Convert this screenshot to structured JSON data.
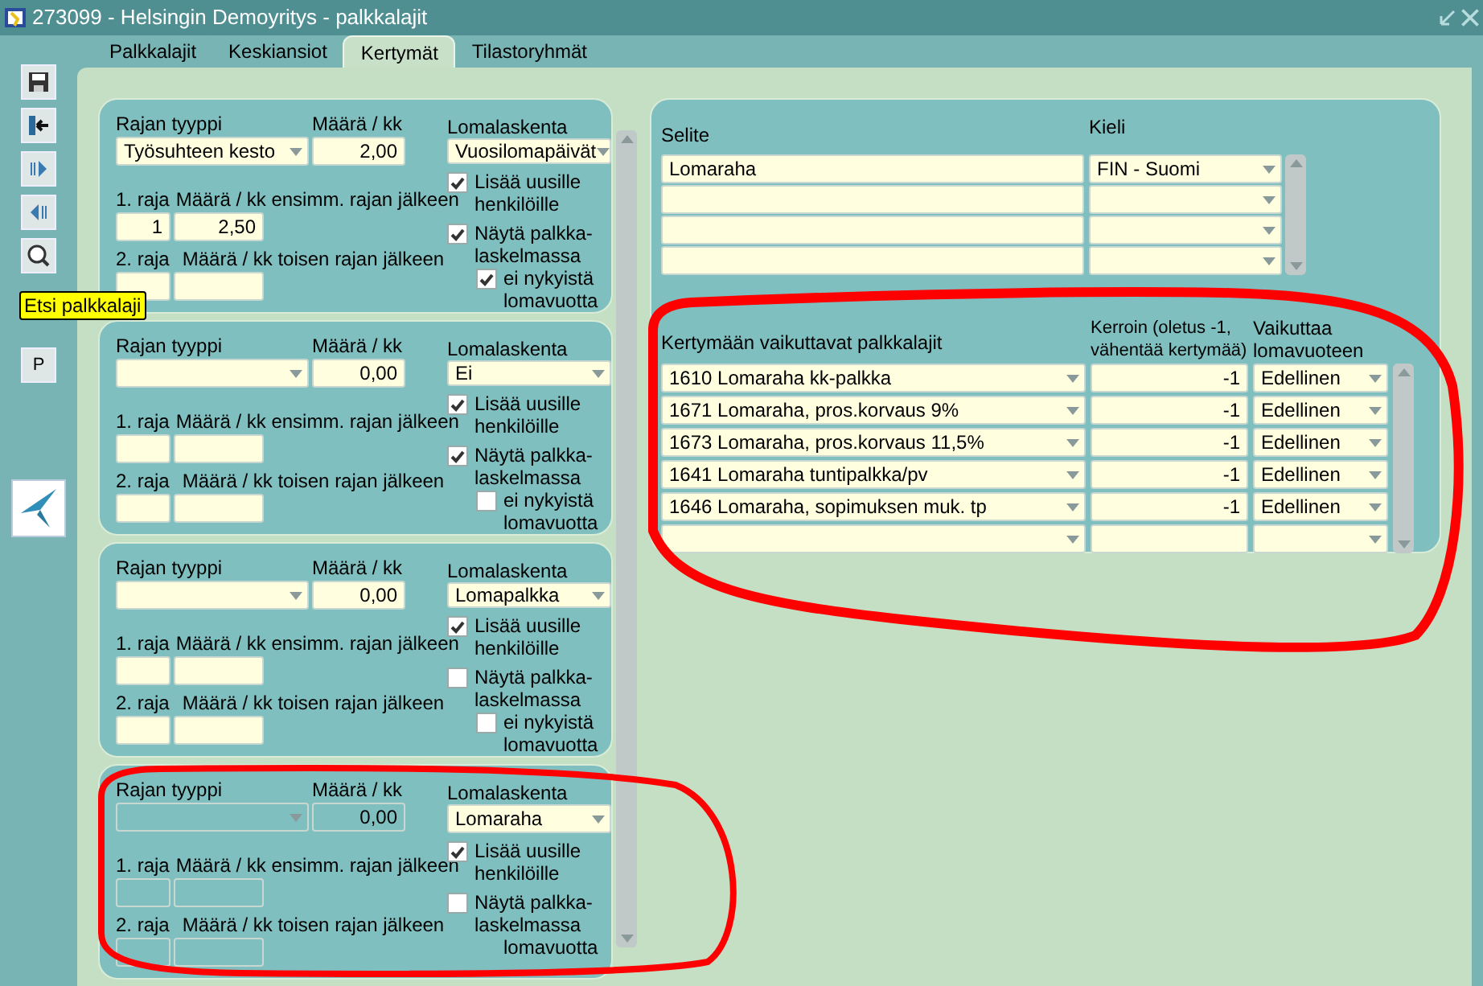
{
  "window": {
    "title": "273099 - Helsingin Demoyritys - palkkalajit"
  },
  "toolbar": {
    "tooltip": "Etsi palkkalaji",
    "p_button": "P"
  },
  "tabs": [
    {
      "label": "Palkkalajit",
      "selected": false
    },
    {
      "label": "Keskiansiot",
      "selected": false
    },
    {
      "label": "Kertymät",
      "selected": true
    },
    {
      "label": "Tilastoryhmät",
      "selected": false
    }
  ],
  "records": [
    {
      "disabled": false,
      "labels": {
        "type": "Rajan tyyppi",
        "amount": "Määrä / kk",
        "vacation_calc": "Lomalaskenta",
        "limit1": "1. raja",
        "amount1": "Määrä / kk ensimm. rajan jälkeen",
        "limit2": "2. raja",
        "amount2": "Määrä / kk toisen rajan jälkeen",
        "add_new": "Lisää uusille henkilöille",
        "show": "Näytä palkka-laskelmassa",
        "not_current": "ei nykyistä lomavuotta"
      },
      "type": "Työsuhteen kesto",
      "amount": "2,00",
      "vacation_calc": "Vuosilomapäivät",
      "limit1": "1",
      "amount1": "2,50",
      "add_new_checked": true,
      "show_checked": true,
      "not_current_checked": true
    },
    {
      "disabled": false,
      "labels": {
        "type": "Rajan tyyppi",
        "amount": "Määrä / kk",
        "vacation_calc": "Lomalaskenta",
        "limit1": "1. raja",
        "amount1": "Määrä / kk ensimm. rajan jälkeen",
        "limit2": "2. raja",
        "amount2": "Määrä / kk toisen rajan jälkeen",
        "add_new": "Lisää uusille henkilöille",
        "show": "Näytä palkka-laskelmassa",
        "not_current": "ei nykyistä lomavuotta"
      },
      "amount": "0,00",
      "vacation_calc": "Ei",
      "add_new_checked": true,
      "show_checked": true,
      "not_current_checked": false
    },
    {
      "disabled": false,
      "labels": {
        "type": "Rajan tyyppi",
        "amount": "Määrä / kk",
        "vacation_calc": "Lomalaskenta",
        "limit1": "1. raja",
        "amount1": "Määrä / kk ensimm. rajan jälkeen",
        "limit2": "2. raja",
        "amount2": "Määrä / kk toisen rajan jälkeen",
        "add_new": "Lisää uusille henkilöille",
        "show": "Näytä palkka-laskelmassa",
        "not_current": "ei nykyistä lomavuotta"
      },
      "amount": "0,00",
      "vacation_calc": "Lomapalkka",
      "add_new_checked": true,
      "show_checked": false,
      "not_current_checked": false
    },
    {
      "disabled": true,
      "labels": {
        "type": "Rajan tyyppi",
        "amount": "Määrä / kk",
        "vacation_calc": "Lomalaskenta",
        "limit1": "1. raja",
        "amount1": "Määrä / kk ensimm. rajan jälkeen",
        "limit2": "2. raja",
        "amount2": "Määrä / kk toisen rajan jälkeen",
        "add_new": "Lisää uusille henkilöille",
        "show": "Näytä palkka-laskelmassa",
        "not_current": "lomavuotta"
      },
      "amount": "0,00",
      "vacation_calc": "Lomaraha",
      "add_new_checked": true,
      "show_checked": false
    }
  ],
  "description_table": {
    "columns": [
      "Selite",
      "Kieli"
    ],
    "rows": [
      {
        "description": "Lomaraha",
        "language": "FIN - Suomi"
      }
    ]
  },
  "wage_table": {
    "columns": [
      "Kertymään vaikuttavat palkkalajit",
      "Kerroin (oletus -1, vähentää kertymää)",
      "Vaikuttaa lomavuoteen"
    ],
    "rows": [
      {
        "wage_type": "1610 Lomaraha kk-palkka",
        "factor": "-1",
        "year": "Edellinen"
      },
      {
        "wage_type": "1671 Lomaraha, pros.korvaus 9%",
        "factor": "-1",
        "year": "Edellinen"
      },
      {
        "wage_type": "1673 Lomaraha, pros.korvaus 11,5%",
        "factor": "-1",
        "year": "Edellinen"
      },
      {
        "wage_type": "1641 Lomaraha tuntipalkka/pv",
        "factor": "-1",
        "year": "Edellinen"
      },
      {
        "wage_type": "1646 Lomaraha, sopimuksen muk. tp",
        "factor": "-1",
        "year": "Edellinen"
      }
    ]
  }
}
